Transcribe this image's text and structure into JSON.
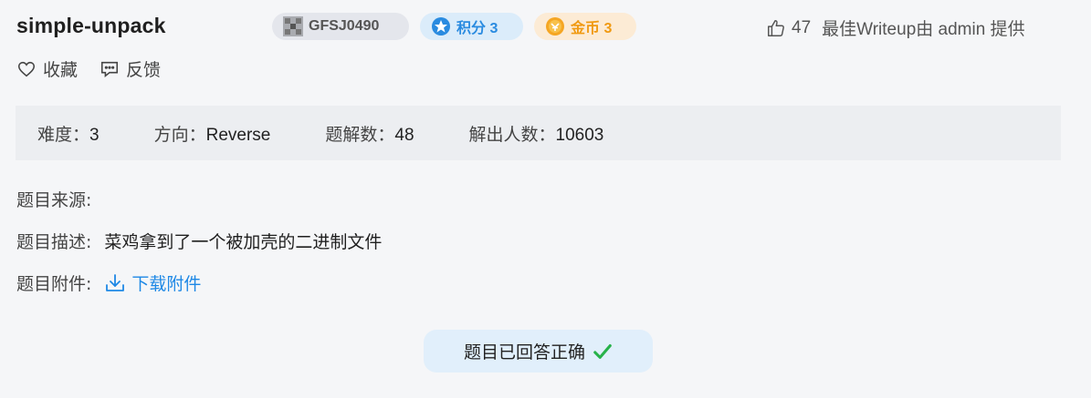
{
  "challenge": {
    "title": "simple-unpack",
    "id_badge": "GFSJ0490",
    "score_badge": "积分 3",
    "coin_badge": "金币 3",
    "likes": "47",
    "writeup_text": "最佳Writeup由 admin 提供"
  },
  "actions": {
    "favorite": "收藏",
    "feedback": "反馈"
  },
  "stats": {
    "difficulty_label": "难度：",
    "difficulty": "3",
    "direction_label": "方向：",
    "direction": "Reverse",
    "writeups_label": "题解数：",
    "writeups": "48",
    "solvers_label": "解出人数：",
    "solvers": "10603"
  },
  "details": {
    "source_label": "题目来源:",
    "source": "",
    "description_label": "题目描述:",
    "description": "菜鸡拿到了一个被加壳的二进制文件",
    "attachment_label": "题目附件:",
    "download": "下载附件"
  },
  "status": {
    "solved": "题目已回答正确"
  },
  "colors": {
    "accent": "#1e88e5",
    "score": "#2a8be0",
    "coin": "#f09a12",
    "check": "#27b24a"
  }
}
